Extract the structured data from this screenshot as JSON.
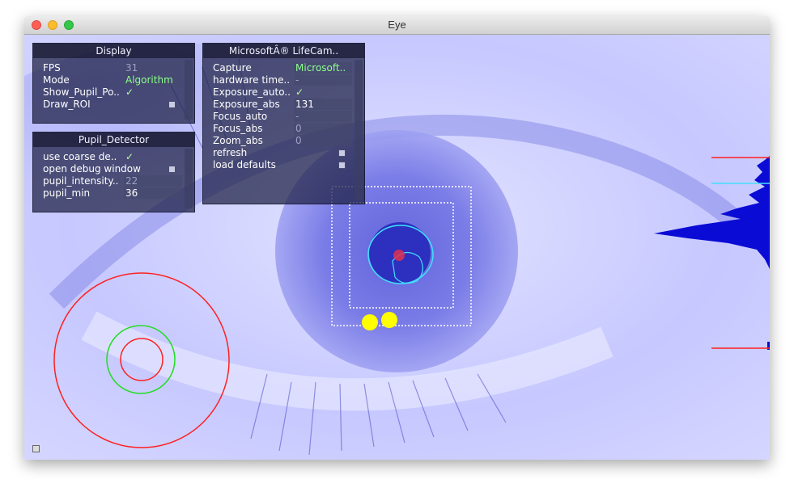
{
  "window": {
    "title": "Eye"
  },
  "display_panel": {
    "title": "Display",
    "rows": [
      {
        "label": "FPS",
        "value": "31"
      },
      {
        "label": "Mode",
        "value": "Algorithm"
      },
      {
        "label": "Show_Pupil_Po..",
        "value": "✓"
      },
      {
        "label": "Draw_ROI",
        "value": ""
      }
    ]
  },
  "camera_panel": {
    "title": "MicrosoftÂ® LifeCam..",
    "rows": [
      {
        "label": "Capture",
        "value": "Microsoft.."
      },
      {
        "label": "hardware time..",
        "value": "-"
      },
      {
        "label": "Exposure_auto..",
        "value": "✓"
      },
      {
        "label": "Exposure_abs",
        "value": "131"
      },
      {
        "label": "Focus_auto",
        "value": "-"
      },
      {
        "label": "Focus_abs",
        "value": "0"
      },
      {
        "label": "Zoom_abs",
        "value": "0"
      },
      {
        "label": "refresh",
        "value": ""
      },
      {
        "label": "load defaults",
        "value": ""
      }
    ]
  },
  "pupil_panel": {
    "title": "Pupil_Detector",
    "rows": [
      {
        "label": "use coarse de..",
        "value": "✓"
      },
      {
        "label": "open debug window",
        "value": ""
      },
      {
        "label": "pupil_intensity..",
        "value": "22"
      },
      {
        "label": "pupil_min",
        "value": "36"
      }
    ]
  },
  "colors": {
    "overlay_red": "#ff2020",
    "overlay_green": "#22dd22",
    "overlay_cyan": "#40e0ff",
    "histogram_blue": "#0b0bd6",
    "glint_yellow": "#ffff00"
  }
}
